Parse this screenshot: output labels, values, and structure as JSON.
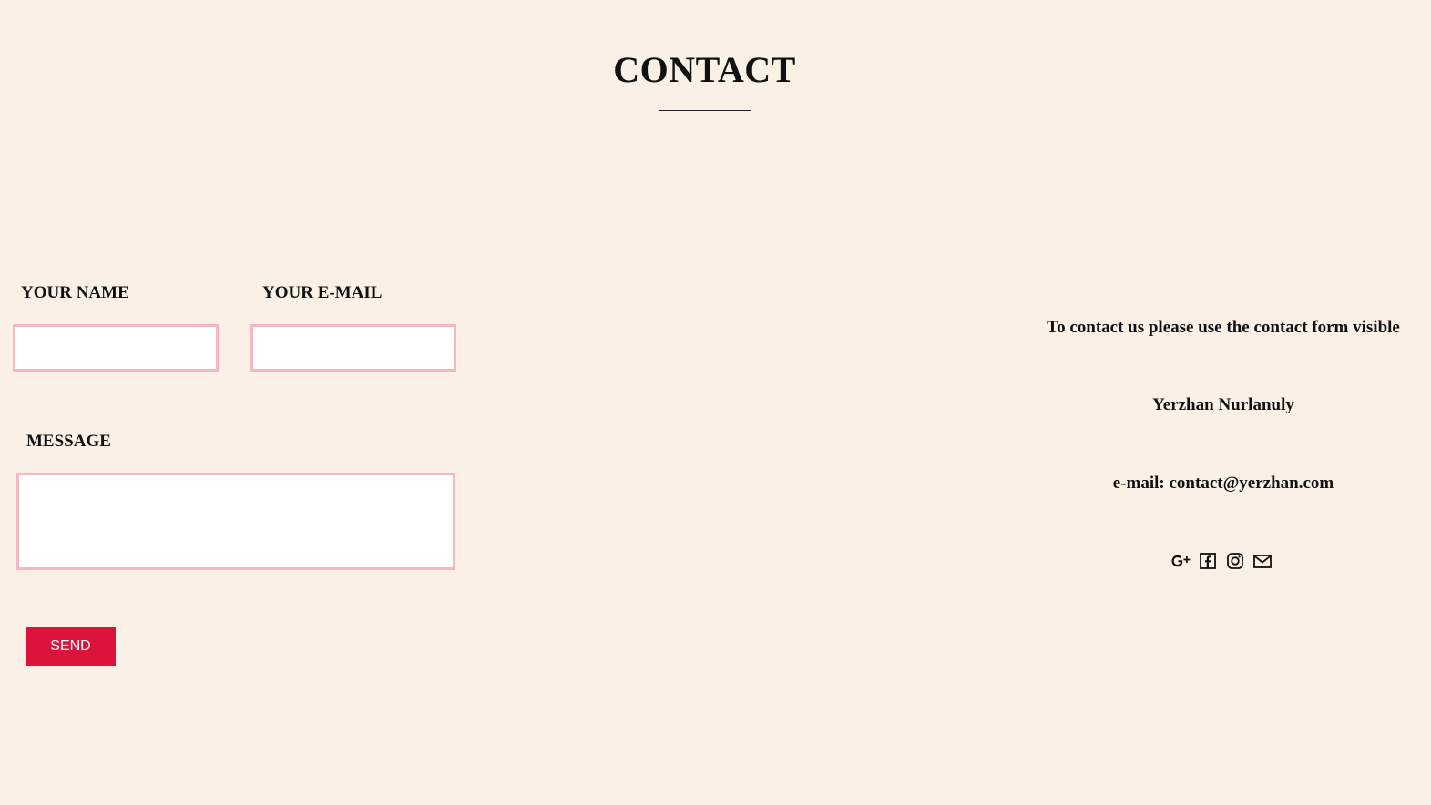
{
  "page": {
    "title": "CONTACT"
  },
  "form": {
    "name_label": "YOUR NAME",
    "email_label": "YOUR E-MAIL",
    "message_label": "MESSAGE",
    "name_value": "",
    "email_value": "",
    "message_value": "",
    "send_label": "SEND"
  },
  "info": {
    "instruction": "To contact us please use the contact form visible",
    "name": "Yerzhan Nurlanuly",
    "email_line": "e-mail: contact@yerzhan.com"
  },
  "social": {
    "icons": [
      "google-plus-icon",
      "facebook-icon",
      "instagram-icon",
      "mail-icon"
    ]
  },
  "colors": {
    "background": "#faf0e6",
    "field_border": "#f7b6c3",
    "button": "#dc143c"
  }
}
